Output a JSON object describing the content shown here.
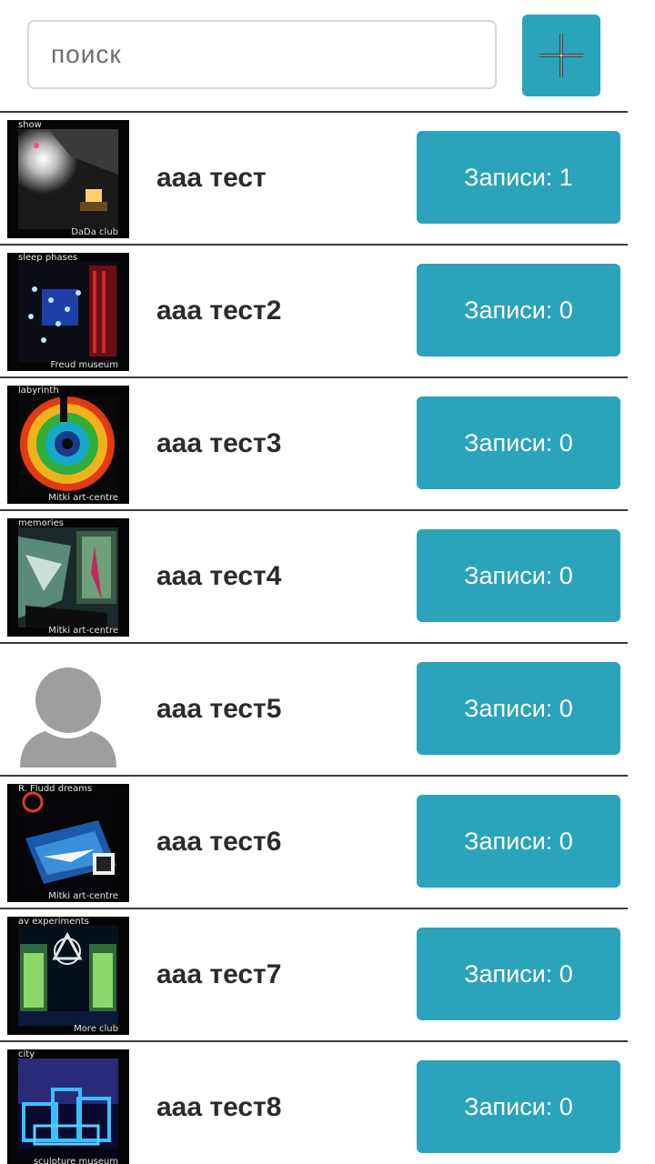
{
  "search": {
    "placeholder": "поиск"
  },
  "colors": {
    "accent": "#2ba3ba",
    "divider": "#3a3a3a"
  },
  "items": [
    {
      "name": "ааа тест",
      "records_label": "Записи: 1",
      "thumb_top": "show",
      "thumb_bottom": "DaDa club"
    },
    {
      "name": "ааа тест2",
      "records_label": "Записи: 0",
      "thumb_top": "sleep phases",
      "thumb_bottom": "Freud museum"
    },
    {
      "name": "ааа тест3",
      "records_label": "Записи: 0",
      "thumb_top": "labyrinth",
      "thumb_bottom": "Mitki art-centre"
    },
    {
      "name": "ааа тест4",
      "records_label": "Записи: 0",
      "thumb_top": "memories",
      "thumb_bottom": "Mitki art-centre"
    },
    {
      "name": "ааа тест5",
      "records_label": "Записи: 0",
      "thumb_top": "",
      "thumb_bottom": ""
    },
    {
      "name": "ааа тест6",
      "records_label": "Записи: 0",
      "thumb_top": "R. Fludd dreams",
      "thumb_bottom": "Mitki art-centre"
    },
    {
      "name": "ааа тест7",
      "records_label": "Записи: 0",
      "thumb_top": "av experiments",
      "thumb_bottom": "More club"
    },
    {
      "name": "ааа тест8",
      "records_label": "Записи: 0",
      "thumb_top": "city",
      "thumb_bottom": "sculpture museum"
    }
  ]
}
